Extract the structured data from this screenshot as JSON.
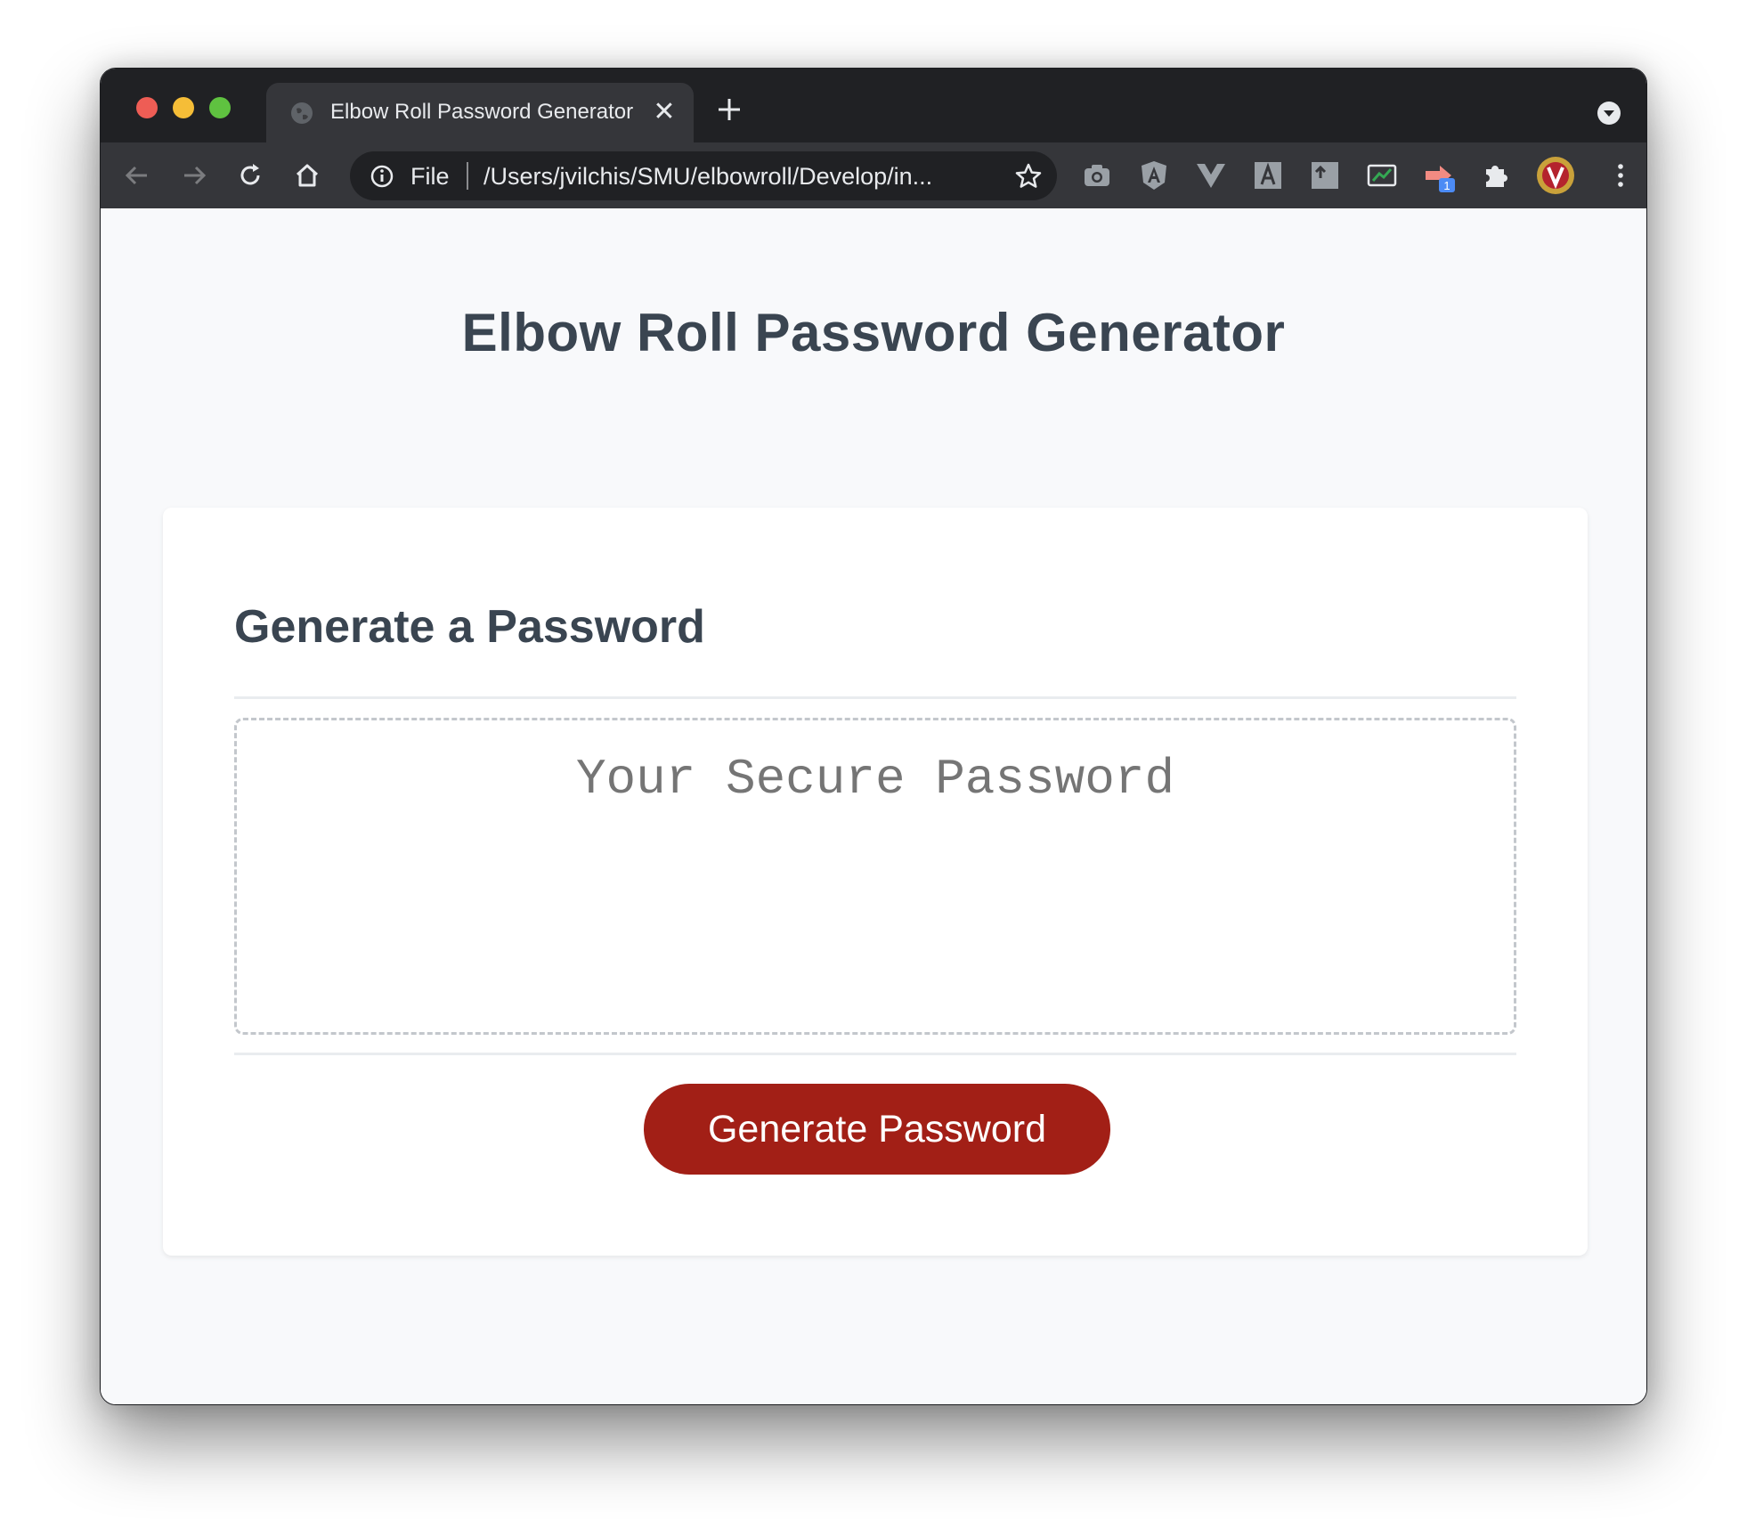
{
  "browser": {
    "tab_title": "Elbow Roll Password Generator",
    "tab_close": "✕",
    "omnibox": {
      "scheme": "File",
      "url": "/Users/jvilchis/SMU/elbowroll/Develop/in..."
    },
    "extension_badge": "1",
    "colors": {
      "tabstrip": "#202124",
      "toolbar": "#35363a",
      "close": "#ee5d55",
      "minimize": "#f5bd37",
      "maximize": "#5fc240"
    }
  },
  "page": {
    "title": "Elbow Roll Password Generator",
    "card": {
      "header": "Generate a Password",
      "password_placeholder": "Your Secure Password",
      "password_value": "",
      "button_label": "Generate Password"
    },
    "colors": {
      "text": "#3a4551",
      "button": "#a21f16",
      "background": "#f8f9fb"
    }
  }
}
